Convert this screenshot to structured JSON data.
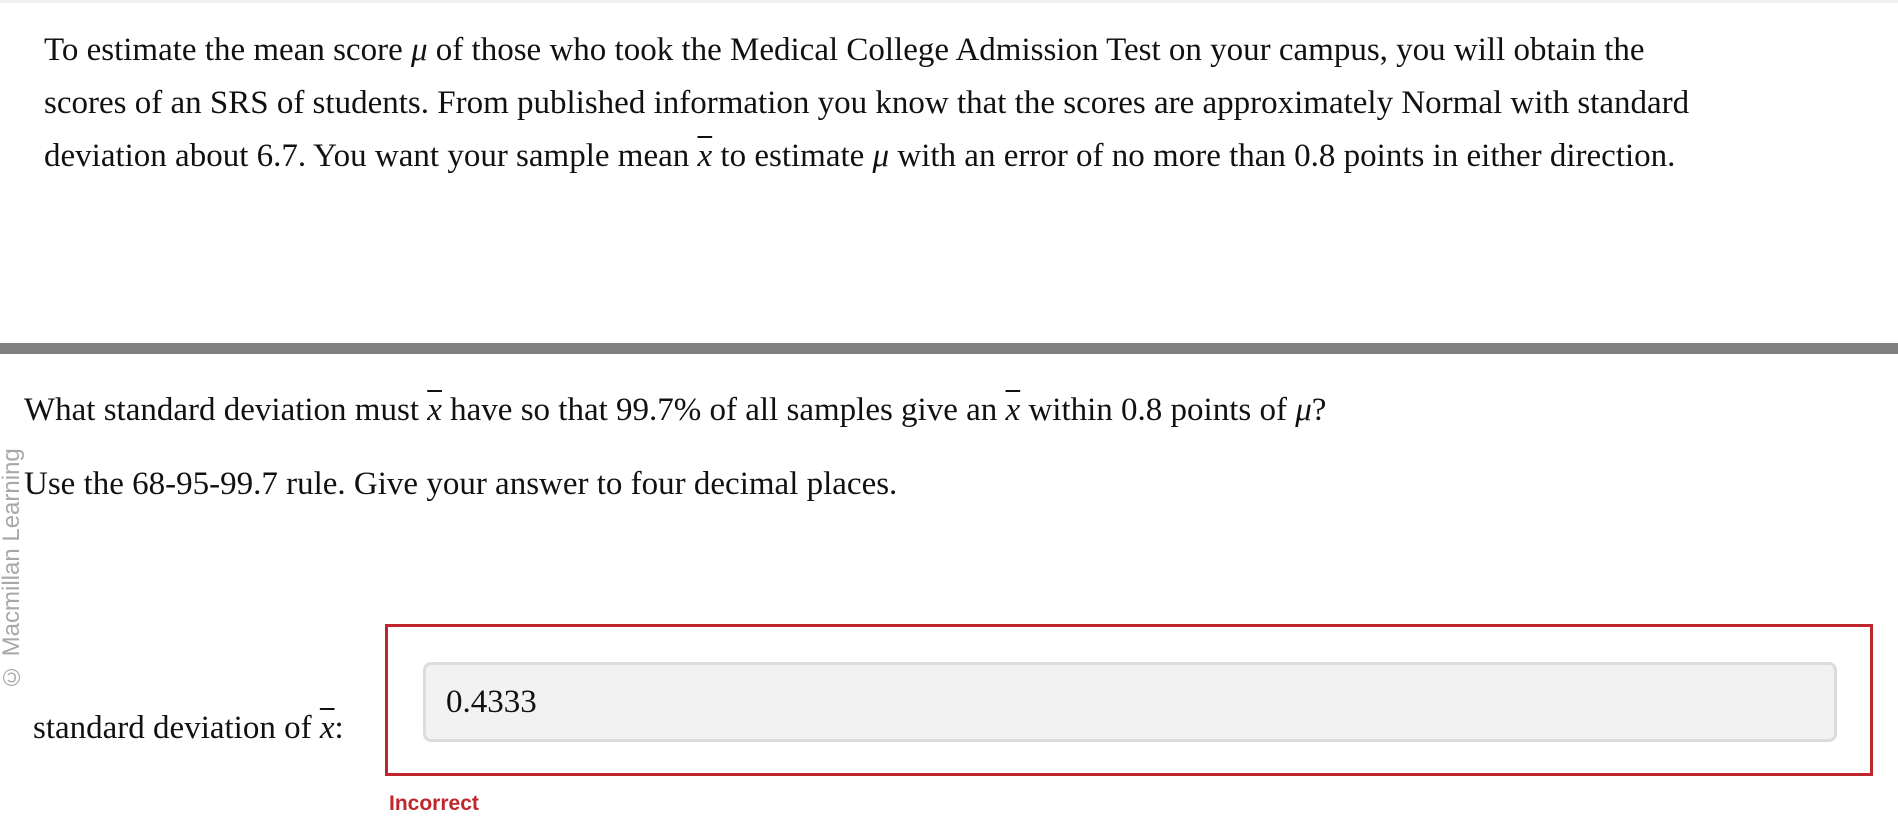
{
  "problem": {
    "line1": {
      "before_mu": "To estimate the mean score ",
      "mu": "μ",
      "after_mu": " of those who took the Medical College Admission Test on your campus, you will obtain the"
    },
    "line2": "scores of an SRS of students. From published information you know that the scores are approximately Normal with standard",
    "line3": {
      "before_xbar": "deviation about 6.7. You want your sample mean ",
      "xbar": "x",
      "middle": " to estimate ",
      "mu": "μ",
      "after_mu": " with an error of no more than 0.8 points in either direction."
    }
  },
  "watermark": "© Macmillan Learning",
  "question": {
    "part1": "What standard deviation must ",
    "xbar1": "x",
    "part2": " have so that 99.7% of all samples give an ",
    "xbar2": "x",
    "part3": " within 0.8 points of ",
    "mu": "μ",
    "part4": "?"
  },
  "instruction": "Use the 68-95-99.7 rule. Give your answer to four decimal places.",
  "answer": {
    "label_prefix": "standard deviation of ",
    "label_xbar": "x",
    "label_suffix": ":",
    "value": "0.4333",
    "feedback": "Incorrect"
  },
  "colors": {
    "error_red": "#c0272d",
    "divider_gray": "#808080",
    "input_bg": "#f2f2f2"
  }
}
